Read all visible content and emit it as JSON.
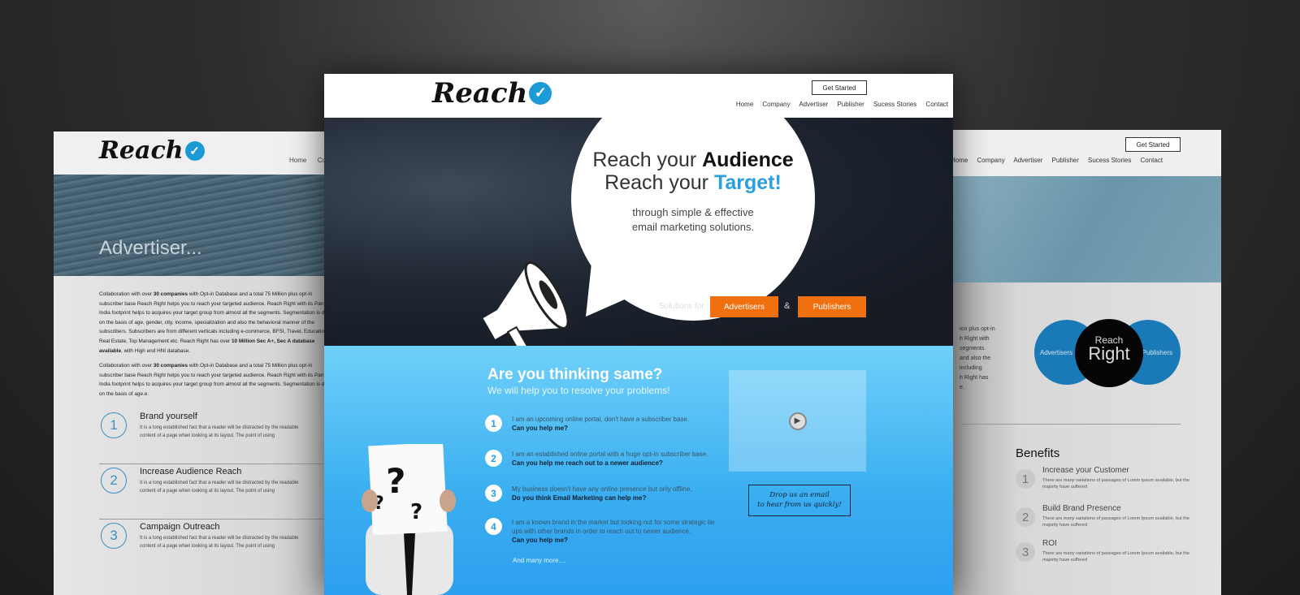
{
  "brand": {
    "logo": "Reach",
    "accent": "#1c9ad6",
    "orange": "#f07010"
  },
  "left": {
    "nav": [
      "Home",
      "Co"
    ],
    "hero_title": "Advertiser...",
    "para1_parts": [
      "Collaboration with over ",
      "30 companies",
      " with Opt-in Database and a total 75 Million plus opt-in subscriber base Reach Right helps you to reach your targeted audience. Reach Right with its Pan India footprint helps to acquires your target group from almost all the segments. Segmentation is done on the basis of age, gender, city, income, specialization and also the behavioral manner of the subscribers. Subscribers are from  different verticals including e-commerce, BFSI, Travel, Education, Real Estate,  Top Management etc. Reach Right has over ",
      "10 Million Sec A+, Sec A database available",
      ", with High end HNI database."
    ],
    "para2_parts": [
      "Collaboration with over ",
      "30 companies",
      " with Opt-in Database and a total 75 Million plus opt-in subscriber base Reach Right helps you to reach your targeted audience. Reach Right with its Pan India footprint helps to acquires your target group from almost all the segments. Segmentation is done on the basis of age.e."
    ],
    "items": [
      {
        "n": "1",
        "title": "Brand yourself",
        "desc": "It is a long established fact that a reader will be distracted by the readable content of a page when looking at its layout. The point of using"
      },
      {
        "n": "2",
        "title": "Increase Audience Reach",
        "desc": "It is a long established fact that a reader will be distracted by the readable content of a page when looking at its layout. The point of using"
      },
      {
        "n": "3",
        "title": "Campaign Outreach",
        "desc": "It is a long established fact that a reader will be distracted by the readable content of a page when looking at its layout. The point of using"
      }
    ]
  },
  "center": {
    "get_started": "Get Started",
    "nav": [
      "Home",
      "Company",
      "Advertiser",
      "Publisher",
      "Sucess Stories",
      "Contact"
    ],
    "bubble": {
      "line1a": "Reach your ",
      "line1b": "Audience",
      "line2a": "Reach your ",
      "line2b": "Target!",
      "sub1": "through simple & effective",
      "sub2": "email marketing solutions."
    },
    "solutions_label": "Solutions for",
    "advertisers_btn": "Advertisers",
    "amp": "&",
    "publishers_btn": "Publishers",
    "q_title": "Are you thinking same?",
    "q_sub": "We will help you to resolve your problems!",
    "questions": [
      {
        "n": "1",
        "text": "I am an upcoming online portal, don't have a subscriber base.",
        "ask": "Can you help me?"
      },
      {
        "n": "2",
        "text": "I am an established online portal with a huge opt-in subscriber base.",
        "ask": "Can you help me reach out to a newer audience?"
      },
      {
        "n": "3",
        "text": "My business doesn't have any online presence but only offline.",
        "ask": "Do you think Email Marketing can help me?"
      },
      {
        "n": "4",
        "text": "I am a known brand in the market but looking out for some strategic tie ups with other brands in order to reach out to newer audience.",
        "ask": "Can you help me?"
      }
    ],
    "more": "And many more....",
    "email_note1": "Drop us an email",
    "email_note2": "to hear from us quickly!"
  },
  "right": {
    "get_started": "Get Started",
    "nav": [
      "Home",
      "Company",
      "Advertiser",
      "Publisher",
      "Sucess Stories",
      "Contact"
    ],
    "text_lines": [
      "ion plus opt-in",
      "h Right with",
      "segments.",
      "and also the",
      "including",
      "h Right has",
      "e."
    ],
    "venn": {
      "left": "Advertisers",
      "center_top": "Reach",
      "center_bottom": "Right",
      "right": "Publishers"
    },
    "benefits_title": "Benefits",
    "benefits": [
      {
        "n": "1",
        "title": "Increase your Customer",
        "desc": "There are many variations of passages of Lorem Ipsum available, but the majority have suffered"
      },
      {
        "n": "2",
        "title": "Build Brand Presence",
        "desc": "There are many variations of passages of Lorem Ipsum available, but the majority have suffered"
      },
      {
        "n": "3",
        "title": "ROI",
        "desc": "There are many variations of passages of Lorem Ipsum available, but the majority have suffered"
      }
    ]
  }
}
